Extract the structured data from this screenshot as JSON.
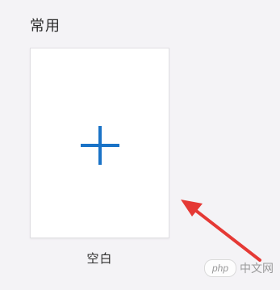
{
  "section": {
    "title": "常用"
  },
  "templates": [
    {
      "label": "空白",
      "icon": "plus-icon",
      "icon_color": "#1a73c7"
    }
  ],
  "annotation": {
    "arrow_color": "#e53935"
  },
  "watermark": {
    "logo_text": "php",
    "site_text": "中文网"
  }
}
